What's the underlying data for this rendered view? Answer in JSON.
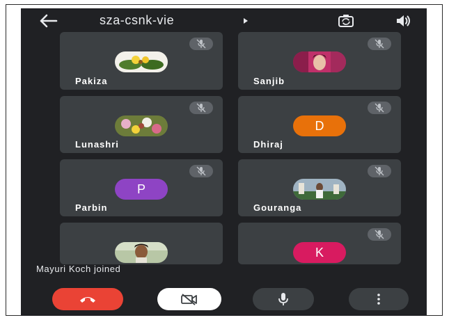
{
  "meeting": {
    "code": "sza-csnk-vie"
  },
  "participants": [
    {
      "name": "Pakiza",
      "avatar_type": "photo"
    },
    {
      "name": "Sanjib",
      "avatar_type": "photo"
    },
    {
      "name": "Lunashri",
      "avatar_type": "photo"
    },
    {
      "name": "Dhiraj",
      "avatar_type": "letter",
      "letter": "D",
      "color": "#e8710a"
    },
    {
      "name": "Parbin",
      "avatar_type": "letter",
      "letter": "P",
      "color": "#8e44c4"
    },
    {
      "name": "Gouranga",
      "avatar_type": "photo"
    },
    {
      "name": "",
      "avatar_type": "photo"
    },
    {
      "name": "",
      "avatar_type": "letter",
      "letter": "K",
      "color": "#d81b60"
    }
  ],
  "notification": {
    "text": "Mayuri Koch joined"
  },
  "colors": {
    "background": "#202124",
    "tile": "#3c4043",
    "end_call": "#ea4335",
    "control_dark": "#3c4043",
    "control_light": "#ffffff"
  },
  "icons": {
    "back": "arrow-left-icon",
    "caret": "caret-right-icon",
    "switch_camera": "switch-camera-icon",
    "speaker": "speaker-icon",
    "mic_off": "mic-off-icon",
    "end_call": "phone-hangup-icon",
    "camera_off": "camera-off-icon",
    "mic": "mic-icon",
    "more": "more-vertical-icon"
  }
}
